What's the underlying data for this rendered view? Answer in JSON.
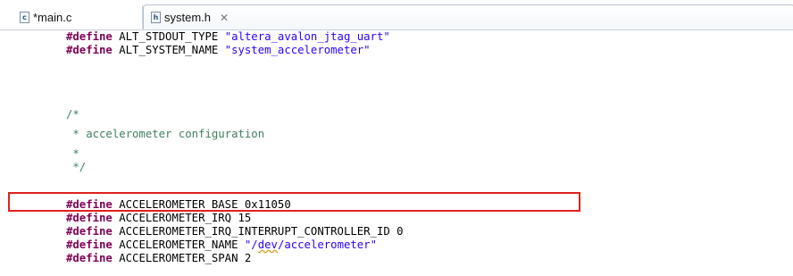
{
  "tabs": [
    {
      "label": "*main.c",
      "icon": "c-file-icon",
      "icon_glyph": "c",
      "active": false
    },
    {
      "label": "system.h",
      "icon": "h-file-icon",
      "icon_glyph": "h",
      "active": true,
      "close_glyph": "✕"
    }
  ],
  "code": {
    "line1": {
      "kw": "#define",
      "name": " ALT_STDOUT_TYPE ",
      "value": "\"altera_avalon_jtag_uart\""
    },
    "line2": {
      "kw": "#define",
      "name": " ALT_SYSTEM_NAME ",
      "value": "\"system_accelerometer\""
    },
    "comment_open": "/*",
    "comment_text": " * accelerometer configuration",
    "comment_star": " *",
    "comment_close": " */",
    "line_base": {
      "kw": "#define",
      "rest": " ACCELEROMETER_BASE 0x11050"
    },
    "line_irq": {
      "kw": "#define",
      "rest": " ACCELEROMETER_IRQ 15"
    },
    "line_irq_ctrl": {
      "kw": "#define",
      "rest": " ACCELEROMETER_IRQ_INTERRUPT_CONTROLLER_ID 0"
    },
    "line_name": {
      "kw": "#define",
      "rest": " ACCELEROMETER_NAME ",
      "str_a": "\"/",
      "str_b": "dev",
      "str_c": "/accelerometer\""
    },
    "line_span": {
      "kw": "#define",
      "rest": " ACCELEROMETER_SPAN 2"
    }
  },
  "colors": {
    "keyword": "#7f0055",
    "string": "#2a00ff",
    "comment": "#3f7f5f",
    "highlight_box": "#e0221c"
  }
}
